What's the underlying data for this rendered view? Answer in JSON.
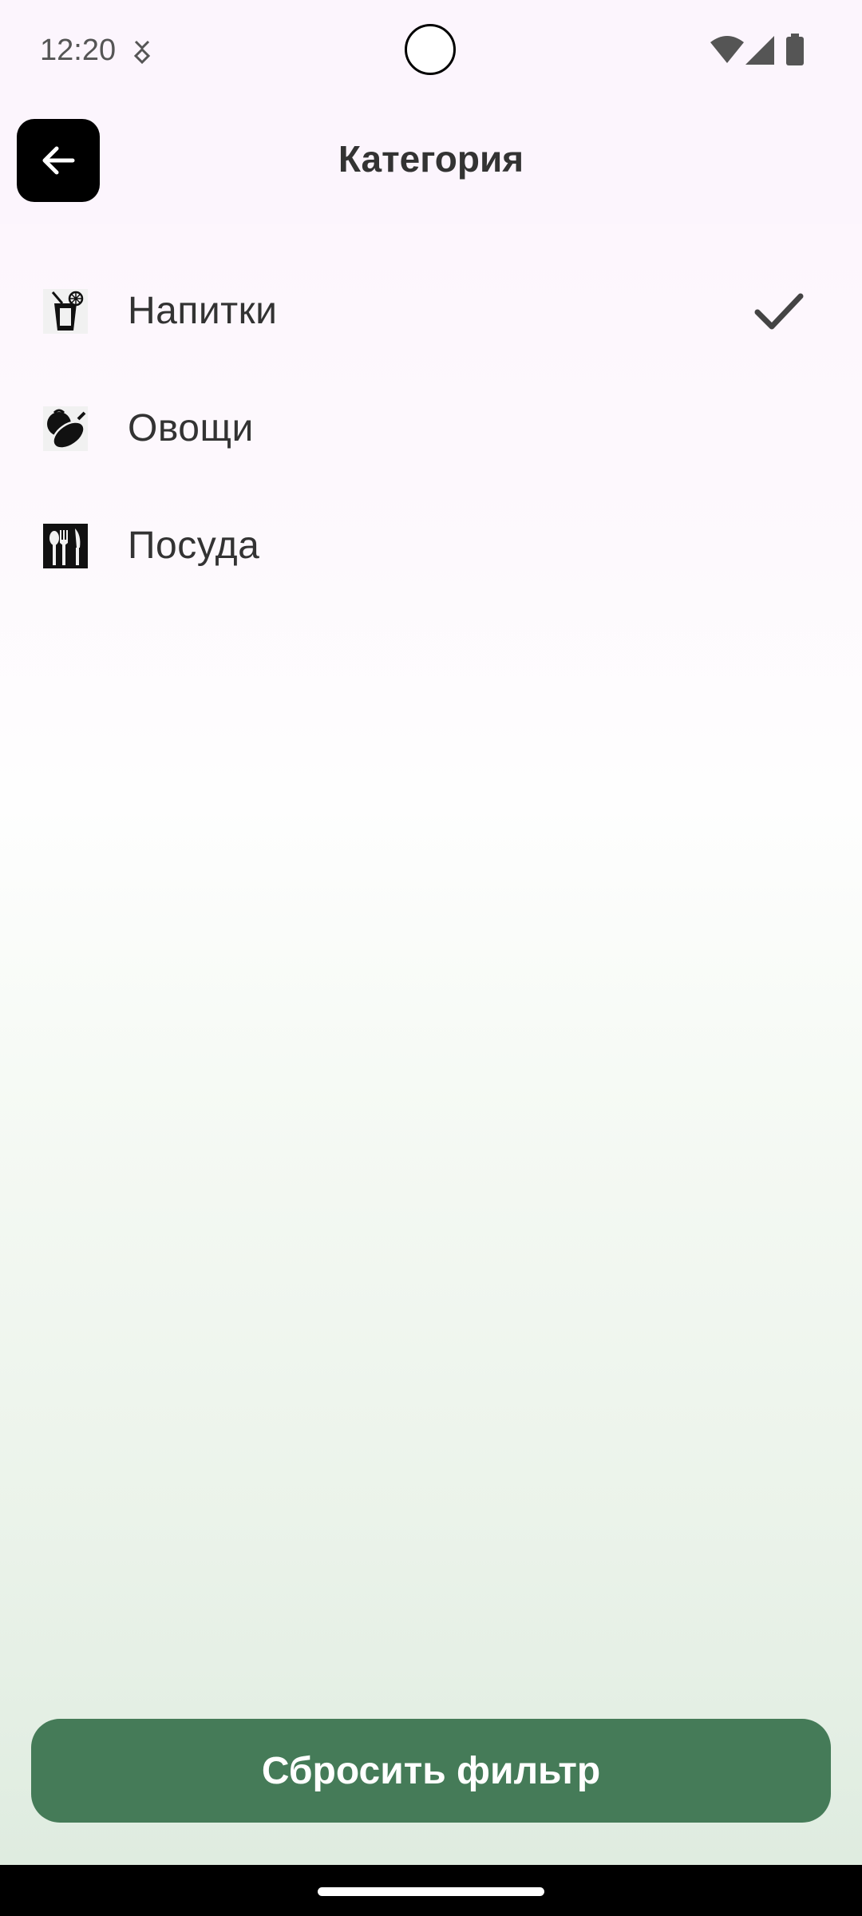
{
  "status_bar": {
    "time": "12:20"
  },
  "app_bar": {
    "title": "Категория"
  },
  "categories": [
    {
      "label": "Напитки",
      "icon": "drink-icon",
      "selected": true
    },
    {
      "label": "Овощи",
      "icon": "vegetables-icon",
      "selected": false
    },
    {
      "label": "Посуда",
      "icon": "tableware-icon",
      "selected": false
    }
  ],
  "actions": {
    "reset_label": "Сбросить фильтр"
  },
  "colors": {
    "accent": "#457b58",
    "back_button": "#000000",
    "header_bg": "#fcf5fd"
  }
}
